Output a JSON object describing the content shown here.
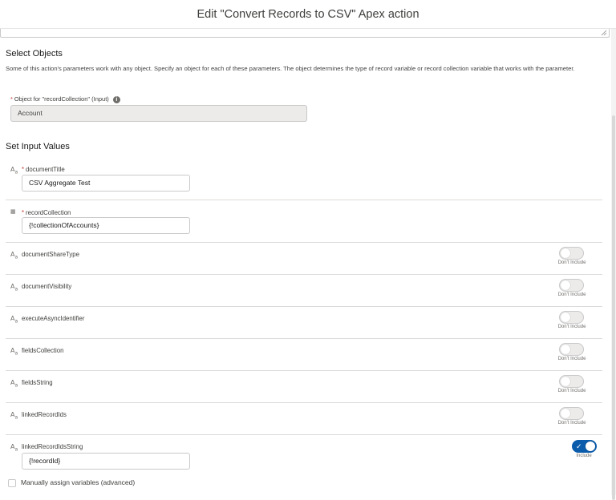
{
  "modal": {
    "title": "Edit \"Convert Records to CSV\" Apex action"
  },
  "select_objects": {
    "heading": "Select Objects",
    "help": "Some of this action's parameters work with any object. Specify an object for each of these parameters. The object determines the type of record variable or record collection variable that works with the parameter.",
    "object_label": "Object for \"recordCollection\" (Input)",
    "object_value": "Account"
  },
  "input_values": {
    "heading": "Set Input Values",
    "params": [
      {
        "name": "documentTitle",
        "required": "*",
        "value": "CSV Aggregate Test",
        "icon": "text-icon"
      },
      {
        "name": "recordCollection",
        "required": "*",
        "value": "{!collectionOfAccounts}",
        "icon": "collection-icon"
      },
      {
        "name": "documentShareType",
        "toggle": "Don't Include",
        "icon": "text-icon"
      },
      {
        "name": "documentVisibility",
        "toggle": "Don't Include",
        "icon": "text-icon"
      },
      {
        "name": "executeAsyncIdentifier",
        "toggle": "Don't Include",
        "icon": "text-icon"
      },
      {
        "name": "fieldsCollection",
        "toggle": "Don't Include",
        "icon": "text-icon"
      },
      {
        "name": "fieldsString",
        "toggle": "Don't Include",
        "icon": "text-icon"
      },
      {
        "name": "linkedRecordIds",
        "toggle": "Don't Include",
        "icon": "text-icon"
      },
      {
        "name": "linkedRecordIdsString",
        "toggle": "Include",
        "value": "{!recordId}",
        "icon": "text-icon"
      }
    ]
  },
  "manual_assign": {
    "label": "Manually assign variables (advanced)"
  },
  "colors": {
    "toggle_on": "#0b5cab",
    "required": "#c23934"
  }
}
